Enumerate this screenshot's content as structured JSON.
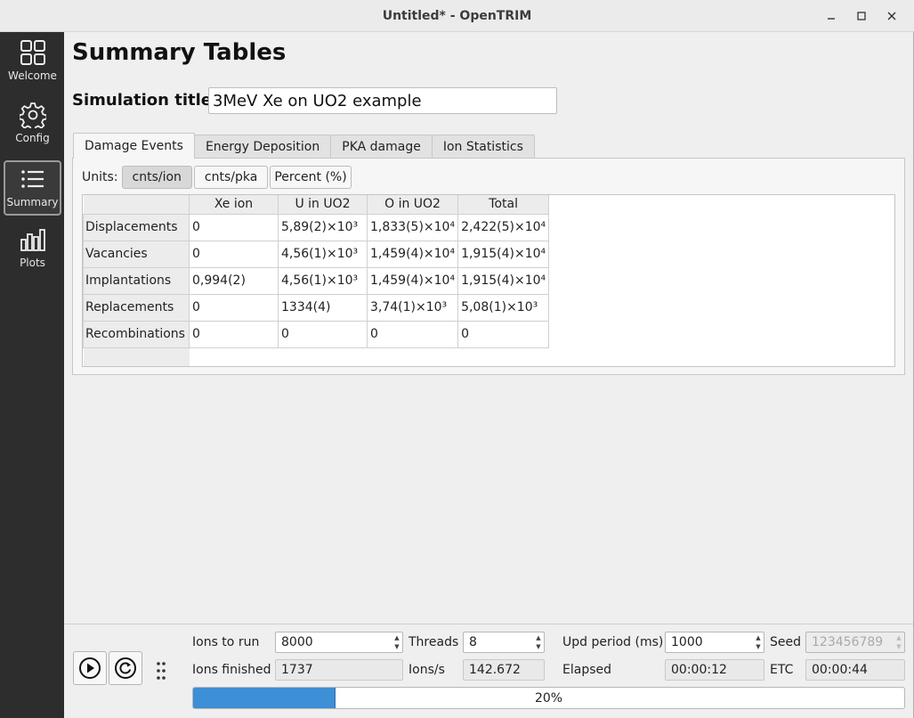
{
  "window": {
    "title": "Untitled* - OpenTRIM",
    "minimize_icon": "minimize-icon",
    "maximize_icon": "maximize-icon",
    "close_icon": "close-icon"
  },
  "sidebar": {
    "items": [
      {
        "label": "Welcome",
        "icon": "grid-icon",
        "active": false
      },
      {
        "label": "Config",
        "icon": "gear-icon",
        "active": false
      },
      {
        "label": "Summary",
        "icon": "list-icon",
        "active": true
      },
      {
        "label": "Plots",
        "icon": "bar-chart-icon",
        "active": false
      }
    ]
  },
  "page": {
    "title": "Summary Tables",
    "sim_title_label": "Simulation title:",
    "sim_title_value": "3MeV Xe on UO2 example"
  },
  "tabs": [
    "Damage Events",
    "Energy Deposition",
    "PKA damage",
    "Ion Statistics"
  ],
  "units": {
    "label": "Units:",
    "options": [
      "cnts/ion",
      "cnts/pka",
      "Percent (%)"
    ],
    "selected": "cnts/ion"
  },
  "table": {
    "columns": [
      "Xe ion",
      "U in UO2",
      "O in UO2",
      "Total"
    ],
    "rows": [
      {
        "name": "Displacements",
        "cells": [
          "0",
          "5,89(2)×10³",
          "1,833(5)×10⁴",
          "2,422(5)×10⁴"
        ]
      },
      {
        "name": "Vacancies",
        "cells": [
          "0",
          "4,56(1)×10³",
          "1,459(4)×10⁴",
          "1,915(4)×10⁴"
        ]
      },
      {
        "name": "Implantations",
        "cells": [
          "0,994(2)",
          "4,56(1)×10³",
          "1,459(4)×10⁴",
          "1,915(4)×10⁴"
        ]
      },
      {
        "name": "Replacements",
        "cells": [
          "0",
          "1334(4)",
          "3,74(1)×10³",
          "5,08(1)×10³"
        ]
      },
      {
        "name": "Recombinations",
        "cells": [
          "0",
          "0",
          "0",
          "0"
        ]
      }
    ]
  },
  "controls": {
    "run_icon": "play-icon",
    "reset_icon": "reset-icon",
    "grip_icon": "drag-handle-icon",
    "ions_to_run_label": "Ions to run",
    "ions_to_run": "8000",
    "threads_label": "Threads",
    "threads": "8",
    "upd_period_label": "Upd period (ms)",
    "upd_period": "1000",
    "seed_label": "Seed",
    "seed": "123456789",
    "ions_finished_label": "Ions finished",
    "ions_finished": "1737",
    "ions_per_s_label": "Ions/s",
    "ions_per_s": "142.672",
    "elapsed_label": "Elapsed",
    "elapsed": "00:00:12",
    "etc_label": "ETC",
    "etc": "00:00:44",
    "progress_percent": 20,
    "progress_text": "20%"
  },
  "colors": {
    "progress_fill": "#3d8fd6",
    "sidebar_bg": "#2d2d2d"
  }
}
